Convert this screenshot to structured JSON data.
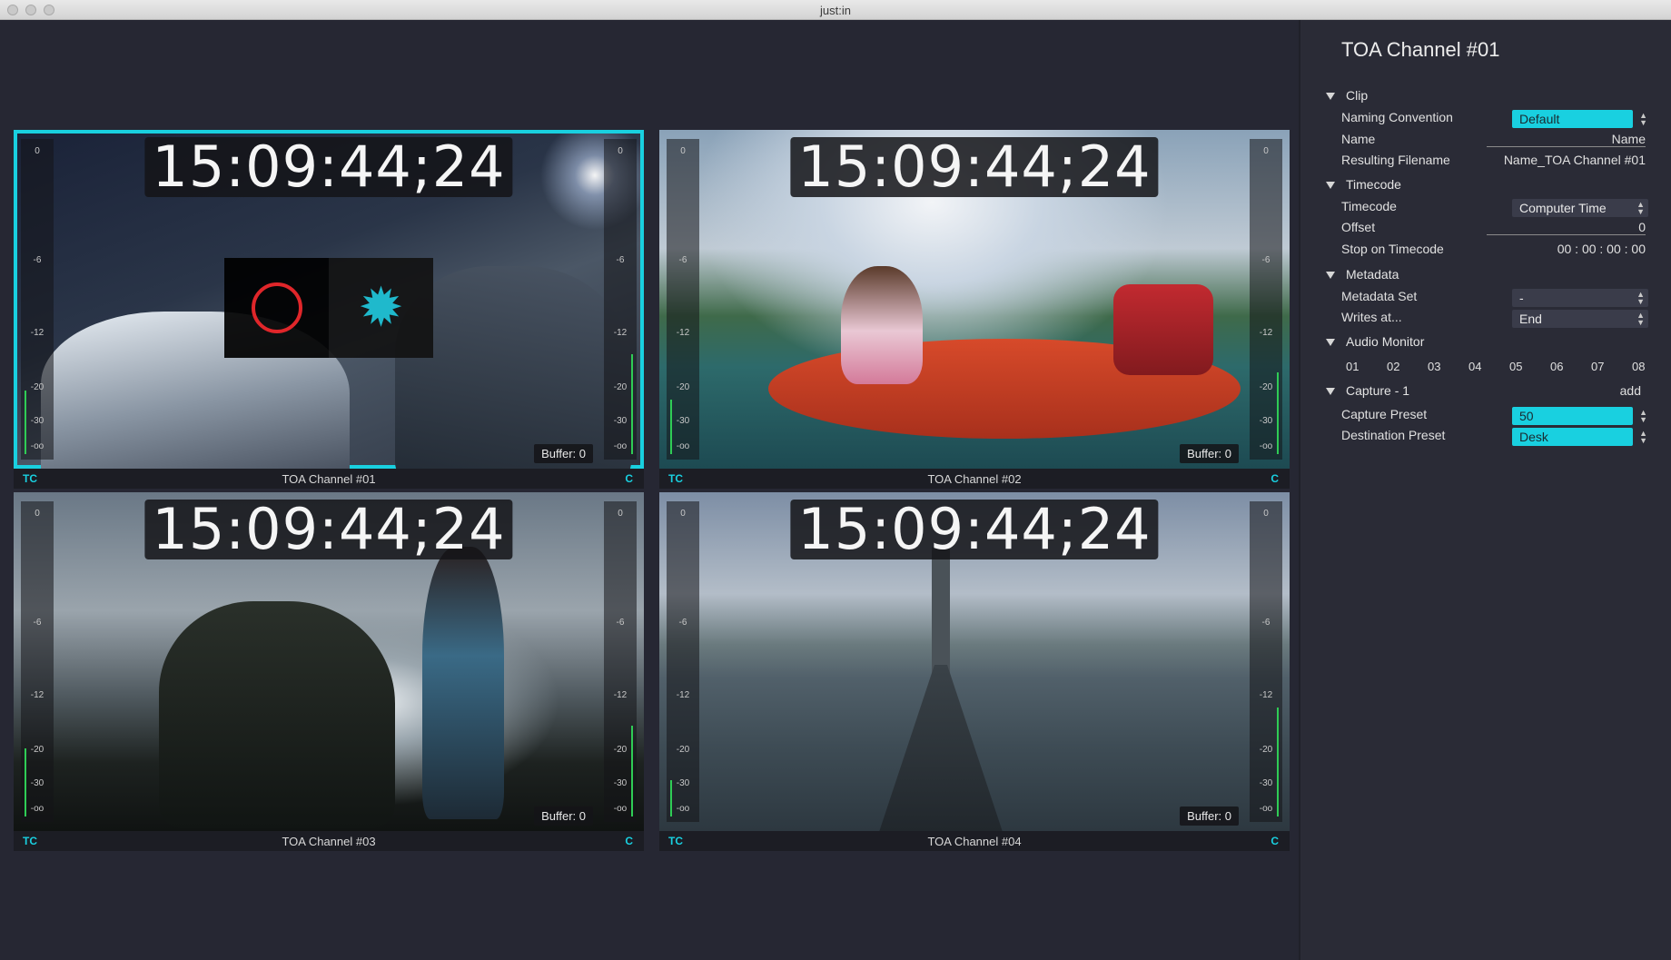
{
  "window": {
    "title": "just:in"
  },
  "channels": [
    {
      "name": "TOA Channel #01",
      "timecode": "15:09:44;24",
      "buffer": "Buffer: 0",
      "tc": "TC",
      "c": "C"
    },
    {
      "name": "TOA Channel #02",
      "timecode": "15:09:44;24",
      "buffer": "Buffer: 0",
      "tc": "TC",
      "c": "C"
    },
    {
      "name": "TOA Channel #03",
      "timecode": "15:09:44;24",
      "buffer": "Buffer: 0",
      "tc": "TC",
      "c": "C"
    },
    {
      "name": "TOA Channel #04",
      "timecode": "15:09:44;24",
      "buffer": "Buffer: 0",
      "tc": "TC",
      "c": "C"
    }
  ],
  "meter_ticks": [
    "0",
    "-6",
    "-12",
    "-20",
    "-30",
    "-oo"
  ],
  "icons": {
    "record": "record-icon",
    "settings": "gear-icon"
  },
  "inspector": {
    "title": "TOA Channel #01",
    "clip": {
      "header": "Clip",
      "naming_label": "Naming Convention",
      "naming_value": "Default",
      "name_label": "Name",
      "name_value": "Name",
      "filename_label": "Resulting Filename",
      "filename_value": "Name_TOA Channel #01"
    },
    "timecode": {
      "header": "Timecode",
      "timecode_label": "Timecode",
      "timecode_value": "Computer Time",
      "offset_label": "Offset",
      "offset_value": "0",
      "stop_label": "Stop on Timecode",
      "stop_value": "00 : 00 : 00 : 00"
    },
    "metadata": {
      "header": "Metadata",
      "set_label": "Metadata Set",
      "set_value": "-",
      "writes_label": "Writes at...",
      "writes_value": "End"
    },
    "audio": {
      "header": "Audio Monitor",
      "channels": [
        "01",
        "02",
        "03",
        "04",
        "05",
        "06",
        "07",
        "08"
      ]
    },
    "capture": {
      "header": "Capture - 1",
      "add": "add",
      "preset_label": "Capture Preset",
      "preset_value": "50",
      "dest_label": "Destination Preset",
      "dest_value": "Desk"
    }
  },
  "colors": {
    "accent": "#19d0e0",
    "record": "#e0262a",
    "meter": "#2fcc55",
    "background": "#262733"
  }
}
